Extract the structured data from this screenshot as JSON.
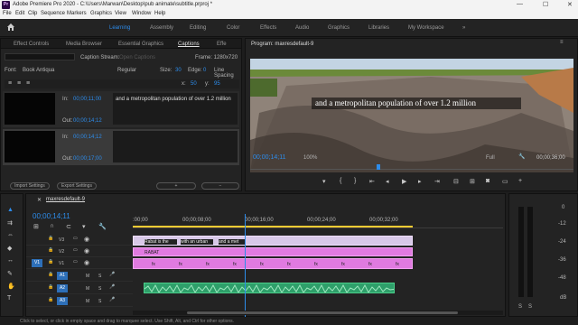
{
  "window": {
    "title": "Adobe Premiere Pro 2020 - C:\\Users\\Marwan\\Desktop\\pub animate\\subtitle.prproj *",
    "app_badge": "Pr"
  },
  "menu": [
    "File",
    "Edit",
    "Clip",
    "Sequence",
    "Markers",
    "Graphics",
    "View",
    "Window",
    "Help"
  ],
  "workspaces": {
    "home_icon": "home-icon",
    "tabs": [
      "Learning",
      "Assembly",
      "Editing",
      "Color",
      "Effects",
      "Audio",
      "Graphics",
      "Libraries",
      "My Workspace"
    ],
    "active": "Learning",
    "more": "»"
  },
  "source_panel": {
    "tabs": [
      "Effect Controls",
      "Media Browser",
      "Essential Graphics",
      "Captions",
      "Effe"
    ],
    "active_tab": "Captions",
    "caption_stream_label": "Caption Stream:",
    "caption_stream_value": "Open Captions",
    "frame_label": "Frame: 1280x720",
    "font_label": "Font:",
    "font_value": "Book Antiqua",
    "style_value": "Regular",
    "size_label": "Size:",
    "size_value": "30",
    "edge_label": "Edge:",
    "edge_value": "0",
    "line_spacing_label": "Line Spacing",
    "x_label": "x:",
    "x_value": "50",
    "y_label": "y:",
    "y_value": "95",
    "captions": [
      {
        "in_label": "In:",
        "in": "00;00;11;00",
        "out_label": "Out:",
        "out": "00;00;14;12",
        "text": "and a metropolitan population of over 1.2 million"
      },
      {
        "in_label": "In:",
        "in": "00;00;14;12",
        "out_label": "Out:",
        "out": "00;00;17;00",
        "text": ""
      }
    ],
    "import_btn": "Import Settings",
    "export_btn": "Export Settings",
    "add_btn": "+",
    "remove_btn": "−"
  },
  "program_monitor": {
    "title": "Program: maxresdefault-9",
    "caption_text": "and a metropolitan population of over 1.2 million",
    "timecode": "00;00;14;11",
    "zoom": "100%",
    "quality": "Full",
    "duration": "00;00;36;00"
  },
  "project_panel": {
    "tabs_icon": "list-icon"
  },
  "timeline": {
    "sequence_name": "maxresdefault-9",
    "timecode": "00;00;14;11",
    "ruler": [
      ":00;00",
      "00;00;08;00",
      "00;00;16;00",
      "00;00;24;00",
      "00;00;32;00"
    ],
    "tracks": [
      {
        "name": "V3",
        "type": "video"
      },
      {
        "name": "V2",
        "type": "video"
      },
      {
        "name": "V1",
        "type": "video"
      },
      {
        "name": "A1",
        "type": "audio"
      },
      {
        "name": "A2",
        "type": "audio"
      },
      {
        "name": "A3",
        "type": "audio"
      }
    ],
    "caption_clips": [
      "Rabat is the",
      "with an urban",
      "and a met"
    ],
    "graphic_label": "RABAT",
    "clip_label": "fx"
  },
  "meter": {
    "ticks": [
      "0",
      "-12",
      "-24",
      "-36",
      "-48",
      "dB"
    ],
    "solo": [
      "S",
      "S"
    ]
  },
  "status": {
    "text": "Click to select, or click in empty space and drag to marquee select. Use Shift, Alt, and Ctrl for other options."
  }
}
